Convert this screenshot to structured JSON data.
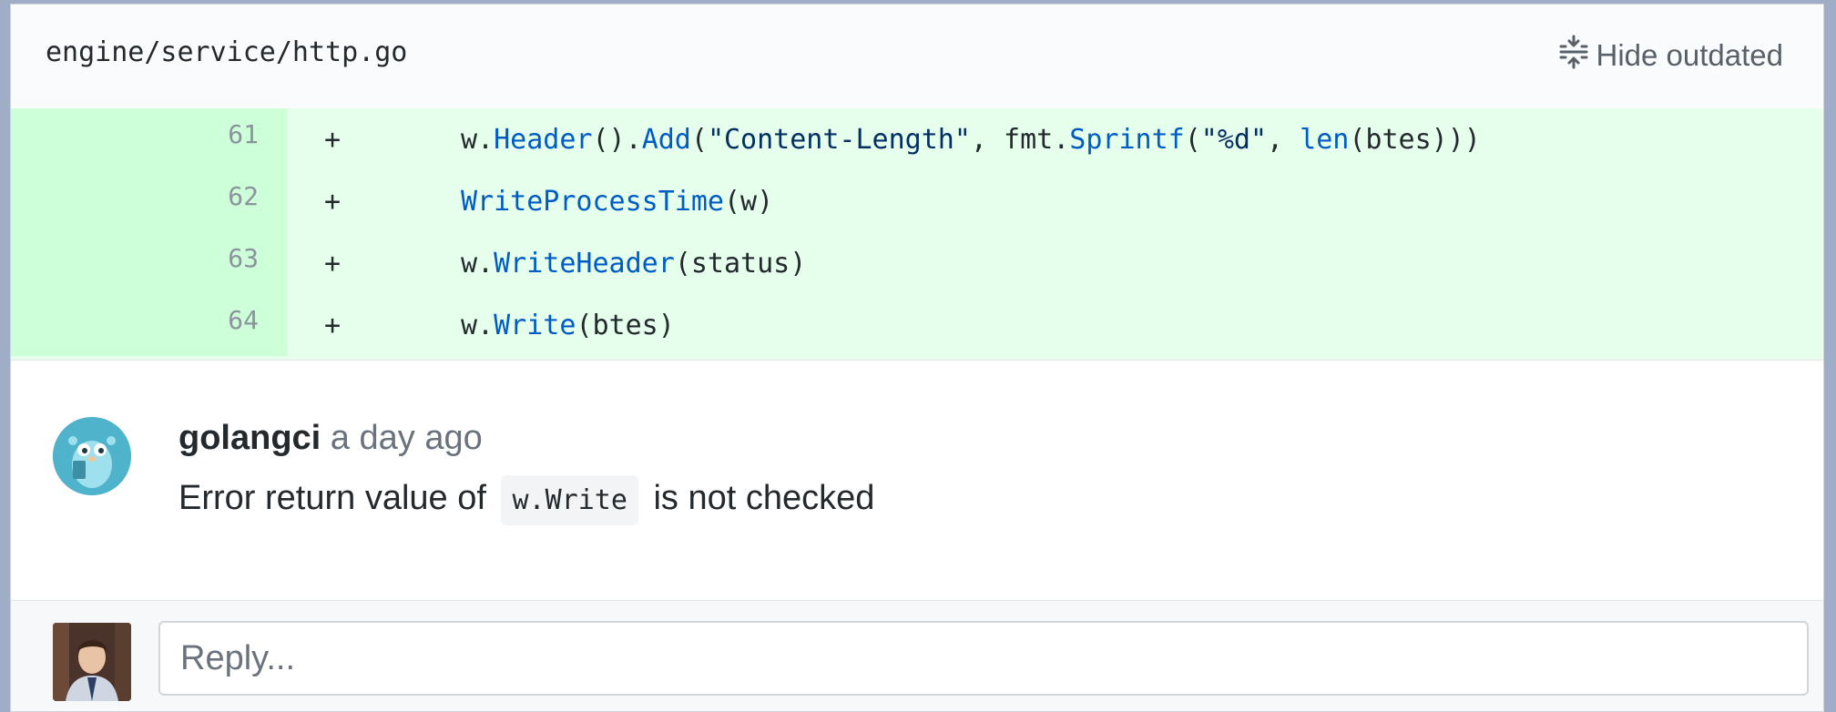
{
  "file": {
    "path": "engine/service/http.go",
    "hide_outdated_label": "Hide outdated",
    "hide_outdated_icon": "unfold-icon"
  },
  "diff": {
    "lines": [
      {
        "number": "61",
        "marker": "+",
        "tokens": [
          {
            "t": "w.",
            "c": "plain"
          },
          {
            "t": "Header",
            "c": "fn"
          },
          {
            "t": "().",
            "c": "plain"
          },
          {
            "t": "Add",
            "c": "fn"
          },
          {
            "t": "(",
            "c": "plain"
          },
          {
            "t": "\"Content-Length\"",
            "c": "str"
          },
          {
            "t": ", fmt.",
            "c": "plain"
          },
          {
            "t": "Sprintf",
            "c": "fn"
          },
          {
            "t": "(",
            "c": "plain"
          },
          {
            "t": "\"%d\"",
            "c": "str"
          },
          {
            "t": ", ",
            "c": "plain"
          },
          {
            "t": "len",
            "c": "fn"
          },
          {
            "t": "(btes)))",
            "c": "plain"
          }
        ]
      },
      {
        "number": "62",
        "marker": "+",
        "tokens": [
          {
            "t": "WriteProcessTime",
            "c": "fn"
          },
          {
            "t": "(w)",
            "c": "plain"
          }
        ]
      },
      {
        "number": "63",
        "marker": "+",
        "tokens": [
          {
            "t": "w.",
            "c": "plain"
          },
          {
            "t": "WriteHeader",
            "c": "fn"
          },
          {
            "t": "(status)",
            "c": "plain"
          }
        ]
      },
      {
        "number": "64",
        "marker": "+",
        "tokens": [
          {
            "t": "w.",
            "c": "plain"
          },
          {
            "t": "Write",
            "c": "fn"
          },
          {
            "t": "(btes)",
            "c": "plain"
          }
        ]
      }
    ]
  },
  "comment": {
    "author": "golangci",
    "time": "a day ago",
    "body_prefix": "Error return value of",
    "body_code": "w.Write",
    "body_suffix": "is not checked"
  },
  "reply": {
    "placeholder": "Reply..."
  },
  "colors": {
    "added_bg": "#e6ffed",
    "added_gutter": "#cdffd8",
    "token_fn": "#005cc5",
    "token_str": "#032f62"
  }
}
